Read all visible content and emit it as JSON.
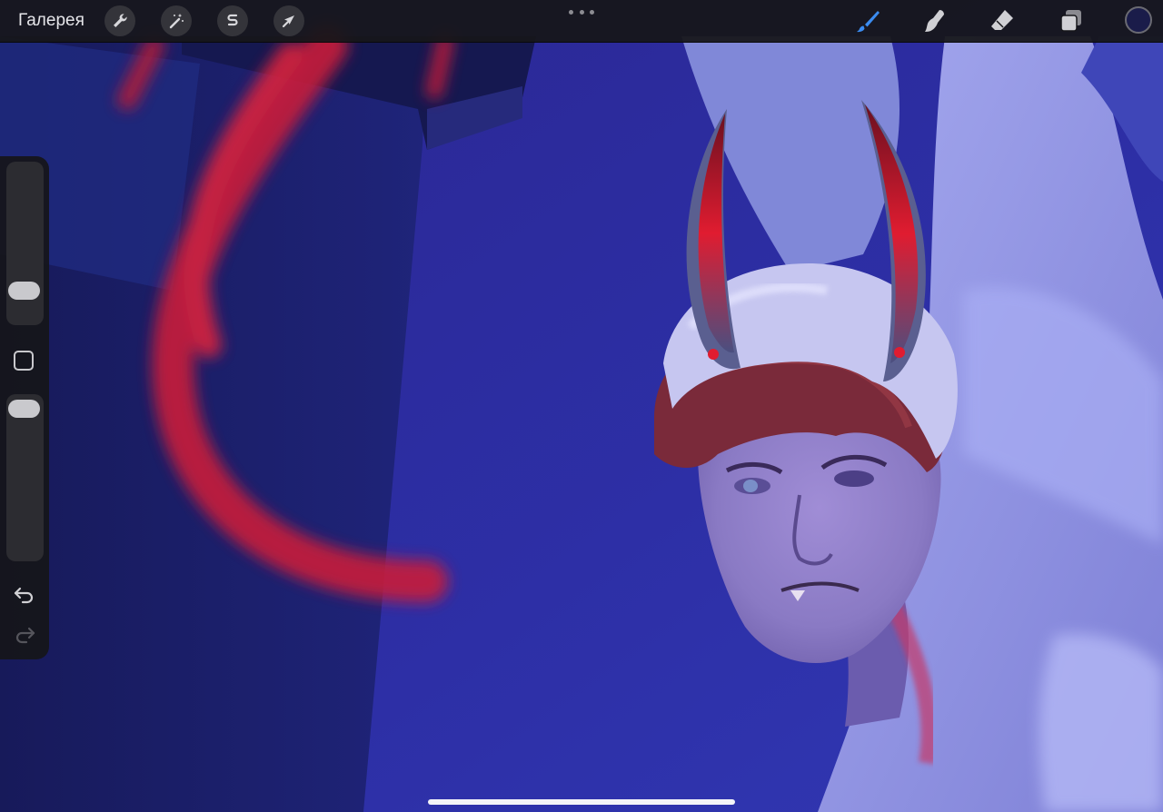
{
  "toolbar": {
    "gallery_label": "Галерея",
    "left_tools": [
      {
        "name": "actions",
        "icon": "wrench-icon"
      },
      {
        "name": "adjustments",
        "icon": "magic-wand-icon"
      },
      {
        "name": "selection",
        "icon": "selection-s-icon"
      },
      {
        "name": "transform",
        "icon": "arrow-cursor-icon"
      }
    ],
    "more_menu_icon": "ellipsis-icon",
    "right_tools": [
      {
        "name": "brush",
        "icon": "brush-icon",
        "active": true,
        "color": "#3b8cf0"
      },
      {
        "name": "smudge",
        "icon": "smudge-finger-icon",
        "active": false
      },
      {
        "name": "eraser",
        "icon": "eraser-icon",
        "active": false
      },
      {
        "name": "layers",
        "icon": "layers-icon",
        "active": false
      }
    ],
    "current_color": "#1a1c4a"
  },
  "sidebar": {
    "brush_size_level": 0.15,
    "opacity_level": 1.0,
    "modify_button_icon": "square-outline-icon",
    "undo_icon": "undo-arrow-icon",
    "redo_icon": "redo-arrow-icon",
    "redo_enabled": false
  },
  "canvas": {
    "background_color": "#2a2c98",
    "accent_red": "#d8203c",
    "skin_tone": "#8f92e0"
  }
}
